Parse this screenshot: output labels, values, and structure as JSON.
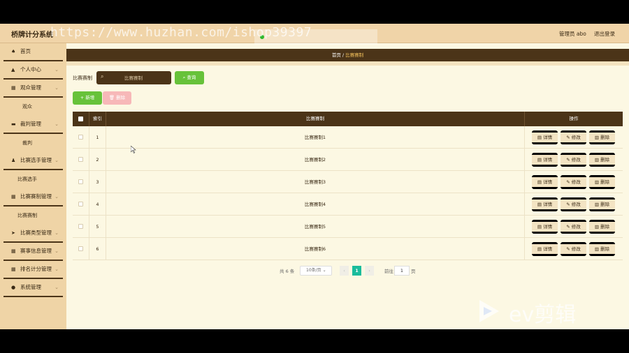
{
  "header": {
    "app_title": "桥牌计分系统",
    "watermark": "https://www.huzhan.com/ishop39397",
    "user": "管理员 abo",
    "logout": "退出登录"
  },
  "sidebar": {
    "items": [
      {
        "label": "首页",
        "icon": "home-icon",
        "glyph": "♠",
        "has_children": false
      },
      {
        "label": "个人中心",
        "icon": "user-icon",
        "glyph": "▲",
        "has_children": true
      },
      {
        "label": "观众管理",
        "icon": "calendar-icon",
        "glyph": "▦",
        "has_children": true,
        "sub": "观众"
      },
      {
        "label": "裁判管理",
        "icon": "briefcase-icon",
        "glyph": "▬",
        "has_children": true,
        "sub": "裁判"
      },
      {
        "label": "比赛选手管理",
        "icon": "person-icon",
        "glyph": "♟",
        "has_children": true,
        "sub": "比赛选手"
      },
      {
        "label": "比赛赛制管理",
        "icon": "grid-icon",
        "glyph": "▦",
        "has_children": true,
        "sub": "比赛赛制"
      },
      {
        "label": "比赛类型管理",
        "icon": "send-icon",
        "glyph": "➤",
        "has_children": true
      },
      {
        "label": "赛事信息管理",
        "icon": "table-icon",
        "glyph": "▦",
        "has_children": true
      },
      {
        "label": "排名计分管理",
        "icon": "table-icon",
        "glyph": "▦",
        "has_children": true
      },
      {
        "label": "系统管理",
        "icon": "settings-icon",
        "glyph": "●",
        "has_children": true
      }
    ]
  },
  "breadcrumb": {
    "home": "首页",
    "sep": "/",
    "current": "比赛赛制"
  },
  "search": {
    "label": "比赛赛制",
    "placeholder": "比赛赛制",
    "button": "查询"
  },
  "toolbar": {
    "add_label": "+ 新增",
    "delete_label": "删除"
  },
  "table": {
    "headers": {
      "index": "索引",
      "name": "比赛赛制",
      "ops": "操作"
    },
    "op_labels": {
      "view": "详情",
      "edit": "修改",
      "del": "删除"
    },
    "rows": [
      {
        "index": "1",
        "name": "比赛赛制1"
      },
      {
        "index": "2",
        "name": "比赛赛制2"
      },
      {
        "index": "3",
        "name": "比赛赛制3"
      },
      {
        "index": "4",
        "name": "比赛赛制4"
      },
      {
        "index": "5",
        "name": "比赛赛制5"
      },
      {
        "index": "6",
        "name": "比赛赛制6"
      }
    ]
  },
  "pagination": {
    "total": "共 6 条",
    "page_size": "10条/页",
    "current_page": "1",
    "goto_label": "前往",
    "goto_value": "1",
    "unit": "页"
  },
  "logo_text": "ev剪辑",
  "colors": {
    "header_bg": "#f0d4a8",
    "sidebar_bg": "#efd4a6",
    "content_bg": "#fcf8e3",
    "accent_dark": "#4b3418",
    "success": "#67c23a",
    "danger_light": "#f7b8b8",
    "pager_active": "#1abc9c"
  }
}
